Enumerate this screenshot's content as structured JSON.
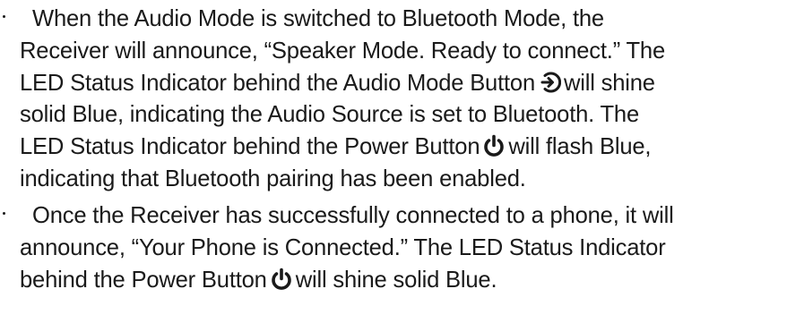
{
  "document": {
    "bullets": [
      {
        "lines": [
          "When the Audio Mode is switched to Bluetooth Mode, the",
          "Receiver will announce, “Speaker Mode. Ready to connect.” The",
          "LED Status Indicator behind the Audio Mode Button",
          "will shine",
          "solid Blue, indicating the Audio Source is set to Bluetooth. The",
          "LED Status Indicator behind the Power Button",
          "will flash Blue,",
          "indicating that Bluetooth pairing has been enabled."
        ],
        "icons": [
          "audio-mode-icon",
          "power-icon"
        ]
      },
      {
        "lines": [
          "Once the Receiver has successfully connected to a phone, it will",
          "announce, “Your Phone is Connected.” The LED Status Indicator",
          "behind the Power Button",
          "will shine solid Blue."
        ],
        "icons": [
          "power-icon"
        ]
      }
    ],
    "bullet_color": "#1a1a1a",
    "text_color": "#1a1a1a"
  }
}
